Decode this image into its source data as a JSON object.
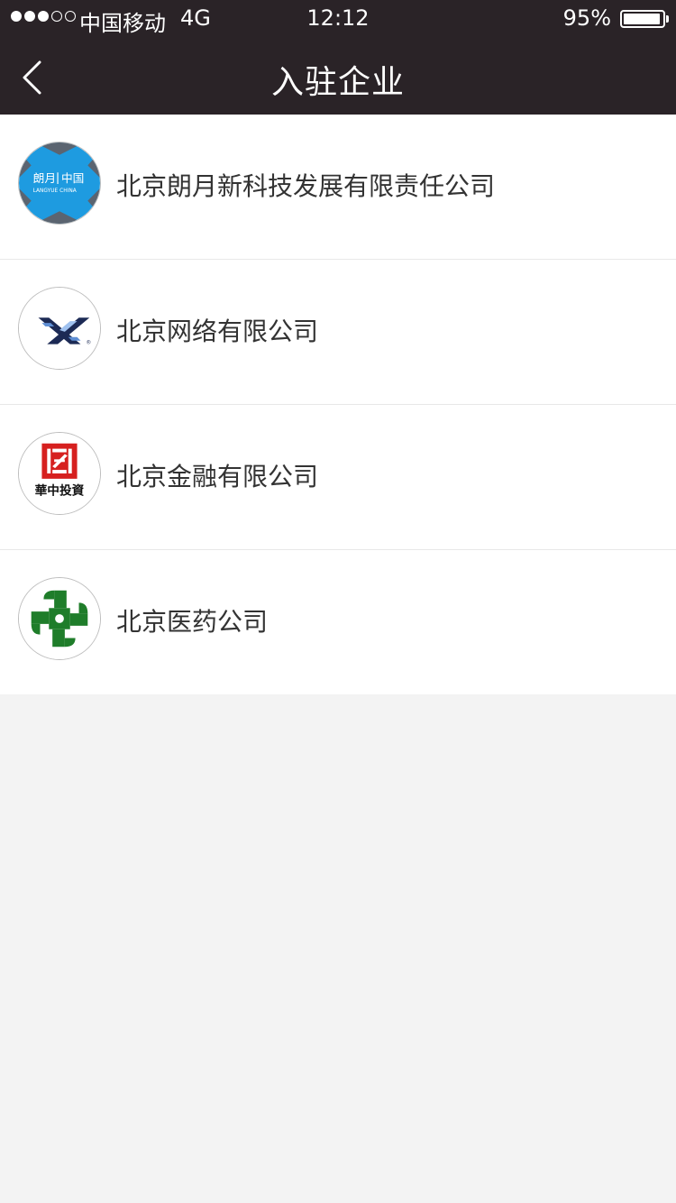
{
  "status_bar": {
    "carrier": "中国移动",
    "network": "4G",
    "time": "12:12",
    "battery": "95%",
    "battery_level": 0.95,
    "signal_bars_filled": 3,
    "signal_bars_total": 5
  },
  "nav": {
    "title": "入驻企业",
    "back_icon": "chevron-left-icon"
  },
  "companies": [
    {
      "name": "北京朗月新科技发展有限责任公司",
      "logo": "langyue-logo",
      "logo_text": [
        "朗月",
        "中国",
        "LANGYUE CHINA"
      ]
    },
    {
      "name": "北京网络有限公司",
      "logo": "x-network-logo",
      "logo_text": [
        "®"
      ]
    },
    {
      "name": "北京金融有限公司",
      "logo": "huazhong-investment-logo",
      "logo_text": [
        "華中投資"
      ]
    },
    {
      "name": "北京医药公司",
      "logo": "green-cross-pharma-logo",
      "logo_text": []
    }
  ],
  "colors": {
    "topbar": "#2a2327",
    "background": "#f3f3f3",
    "list_bg": "#ffffff",
    "divider": "#e8e8e8",
    "text": "#333333",
    "langyue_blue": "#1e9be0",
    "x_navy": "#1c2a55",
    "huazhong_red": "#d6201f",
    "pharma_green": "#1f7d2a"
  }
}
